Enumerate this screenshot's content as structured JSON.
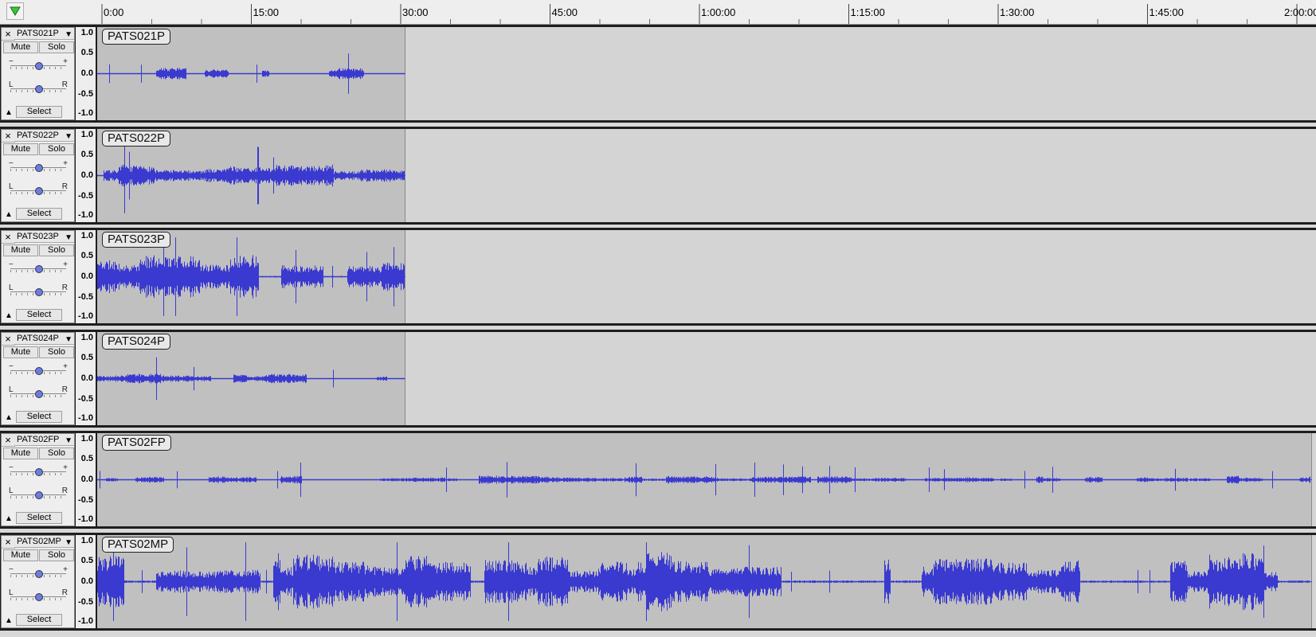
{
  "ruler": {
    "ticks": [
      "0:00",
      "15:00",
      "30:00",
      "45:00",
      "1:00:00",
      "1:15:00",
      "1:30:00",
      "1:45:00",
      "2:00:00"
    ]
  },
  "common": {
    "mute_label": "Mute",
    "solo_label": "Solo",
    "select_label": "Select",
    "close_glyph": "×",
    "dropdown_glyph": "▼",
    "collapse_glyph": "▲",
    "gain_min": "−",
    "gain_max": "+",
    "pan_left": "L",
    "pan_right": "R",
    "scale": [
      "1.0",
      "0.5",
      "0.0",
      "-0.5",
      "-1.0"
    ],
    "wave_color": "#3a3ad0"
  },
  "tracks": [
    {
      "name": "PATS021P",
      "clip_name": "PATS021P",
      "clip_end_minutes": 30.5,
      "amplitude": 0.25,
      "seed": 3
    },
    {
      "name": "PATS022P",
      "clip_name": "PATS022P",
      "clip_end_minutes": 30.5,
      "amplitude": 0.28,
      "seed": 7
    },
    {
      "name": "PATS023P",
      "clip_name": "PATS023P",
      "clip_end_minutes": 30.5,
      "amplitude": 0.55,
      "seed": 11
    },
    {
      "name": "PATS024P",
      "clip_name": "PATS024P",
      "clip_end_minutes": 30.5,
      "amplitude": 0.12,
      "seed": 19
    },
    {
      "name": "PATS02FP",
      "clip_name": "PATS02FP",
      "clip_end_minutes": 121.5,
      "amplitude": 0.1,
      "seed": 23
    },
    {
      "name": "PATS02MP",
      "clip_name": "PATS02MP",
      "clip_end_minutes": 121.5,
      "amplitude": 0.75,
      "seed": 31
    }
  ]
}
